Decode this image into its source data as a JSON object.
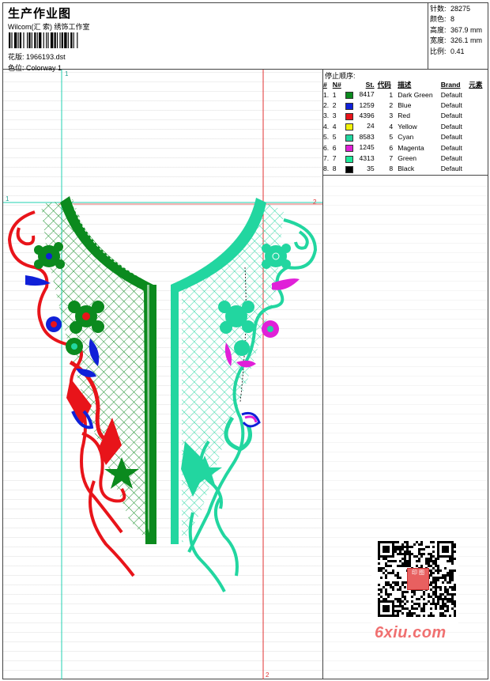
{
  "header": {
    "title": "生产作业图",
    "subtitle": "Wilcom(汇 索) 绣饰工作室",
    "design_label": "花版:",
    "design_file": "1966193.dst",
    "colorway_label": "色位:",
    "colorway": "Colorway 1"
  },
  "stats": [
    {
      "label": "针数:",
      "value": "28275"
    },
    {
      "label": "颜色:",
      "value": "8"
    },
    {
      "label": "高度:",
      "value": "367.9 mm"
    },
    {
      "label": "宽度:",
      "value": "326.1 mm"
    },
    {
      "label": "比例:",
      "value": "0.41"
    }
  ],
  "stop_sequence": {
    "title": "停止顺序:",
    "headers": [
      "#",
      "N#",
      "St.",
      "代码",
      "描述",
      "Brand",
      "元素"
    ],
    "rows": [
      {
        "num": "1.",
        "n": "1",
        "color": "#0b8a1e",
        "stitches": "8417",
        "code": "1",
        "desc": "Dark Green",
        "brand": "Default"
      },
      {
        "num": "2.",
        "n": "2",
        "color": "#1020d8",
        "stitches": "1259",
        "code": "2",
        "desc": "Blue",
        "brand": "Default"
      },
      {
        "num": "3.",
        "n": "3",
        "color": "#e8141a",
        "stitches": "4396",
        "code": "3",
        "desc": "Red",
        "brand": "Default"
      },
      {
        "num": "4.",
        "n": "4",
        "color": "#f2f20a",
        "stitches": "24",
        "code": "4",
        "desc": "Yellow",
        "brand": "Default"
      },
      {
        "num": "5.",
        "n": "5",
        "color": "#22d6a0",
        "stitches": "8583",
        "code": "5",
        "desc": "Cyan",
        "brand": "Default"
      },
      {
        "num": "6.",
        "n": "6",
        "color": "#e020d8",
        "stitches": "1245",
        "code": "6",
        "desc": "Magenta",
        "brand": "Default"
      },
      {
        "num": "7.",
        "n": "7",
        "color": "#1ee89a",
        "stitches": "4313",
        "code": "7",
        "desc": "Green",
        "brand": "Default"
      },
      {
        "num": "8.",
        "n": "8",
        "color": "#000000",
        "stitches": "35",
        "code": "8",
        "desc": "Black",
        "brand": "Default"
      }
    ]
  },
  "guides": {
    "vertical_left": "1",
    "vertical_right_top": "2",
    "horizontal_left": "1",
    "horizontal_right": "2",
    "vertical_right_bottom": "2"
  },
  "watermark": {
    "text": "6xiu.com",
    "seal_text": "印 图"
  }
}
